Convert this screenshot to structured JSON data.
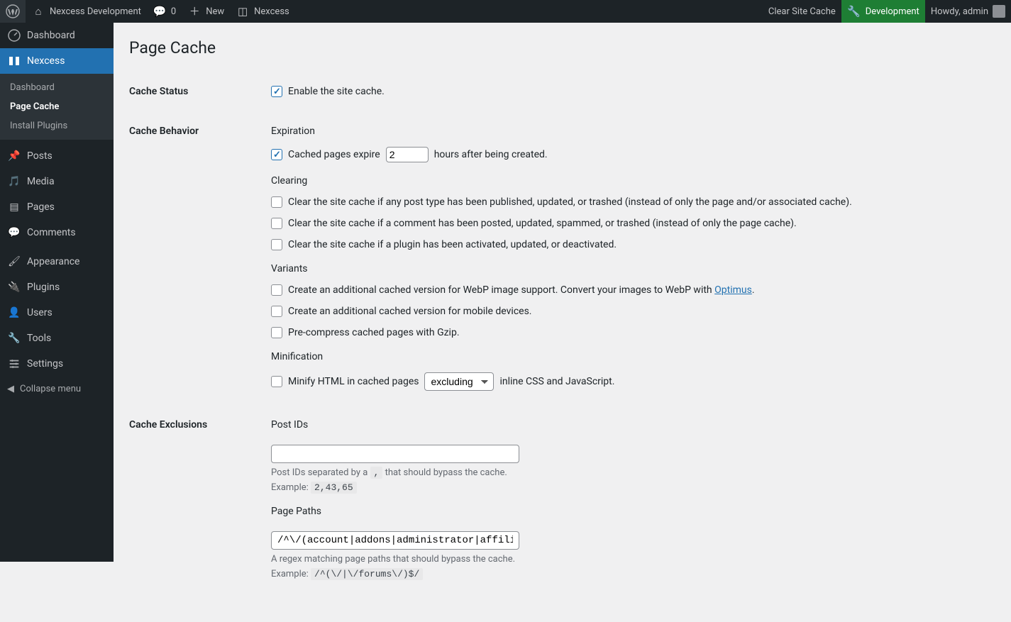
{
  "toolbar": {
    "site_name": "Nexcess Development",
    "comments_count": "0",
    "new_label": "New",
    "nexcess_label": "Nexcess",
    "clear_cache": "Clear Site Cache",
    "development": "Development",
    "howdy": "Howdy, admin"
  },
  "sidebar": {
    "items": [
      {
        "label": "Dashboard"
      },
      {
        "label": "Nexcess"
      },
      {
        "label": "Posts"
      },
      {
        "label": "Media"
      },
      {
        "label": "Pages"
      },
      {
        "label": "Comments"
      },
      {
        "label": "Appearance"
      },
      {
        "label": "Plugins"
      },
      {
        "label": "Users"
      },
      {
        "label": "Tools"
      },
      {
        "label": "Settings"
      }
    ],
    "submenu": {
      "dashboard": "Dashboard",
      "page_cache": "Page Cache",
      "install_plugins": "Install Plugins"
    },
    "collapse": "Collapse menu"
  },
  "page": {
    "title": "Page Cache",
    "sections": {
      "cache_status": {
        "heading": "Cache Status",
        "enable_label": "Enable the site cache."
      },
      "cache_behavior": {
        "heading": "Cache Behavior",
        "expiration_label": "Expiration",
        "expire_prefix": "Cached pages expire",
        "expire_value": "2",
        "expire_suffix": "hours after being created.",
        "clearing_label": "Clearing",
        "clear_post": "Clear the site cache if any post type has been published, updated, or trashed (instead of only the page and/or associated cache).",
        "clear_comment": "Clear the site cache if a comment has been posted, updated, spammed, or trashed (instead of only the page cache).",
        "clear_plugin": "Clear the site cache if a plugin has been activated, updated, or deactivated.",
        "variants_label": "Variants",
        "variant_webp_prefix": "Create an additional cached version for WebP image support. Convert your images to WebP with ",
        "variant_webp_link": "Optimus",
        "variant_webp_suffix": ".",
        "variant_mobile": "Create an additional cached version for mobile devices.",
        "variant_gzip": "Pre-compress cached pages with Gzip.",
        "minification_label": "Minification",
        "minify_prefix": "Minify HTML in cached pages",
        "minify_select": "excluding",
        "minify_suffix": "inline CSS and JavaScript."
      },
      "cache_exclusions": {
        "heading": "Cache Exclusions",
        "post_ids_label": "Post IDs",
        "post_ids_value": "",
        "post_ids_desc_prefix": "Post IDs separated by a ",
        "post_ids_desc_code": ",",
        "post_ids_desc_suffix": " that should bypass the cache.",
        "post_ids_example_label": "Example: ",
        "post_ids_example_code": "2,43,65",
        "page_paths_label": "Page Paths",
        "page_paths_value": "/^\\/(account|addons|administrator|affili",
        "page_paths_desc": "A regex matching page paths that should bypass the cache.",
        "page_paths_example_label": "Example: ",
        "page_paths_example_code": "/^(\\/|\\/forums\\/)$/"
      }
    }
  }
}
